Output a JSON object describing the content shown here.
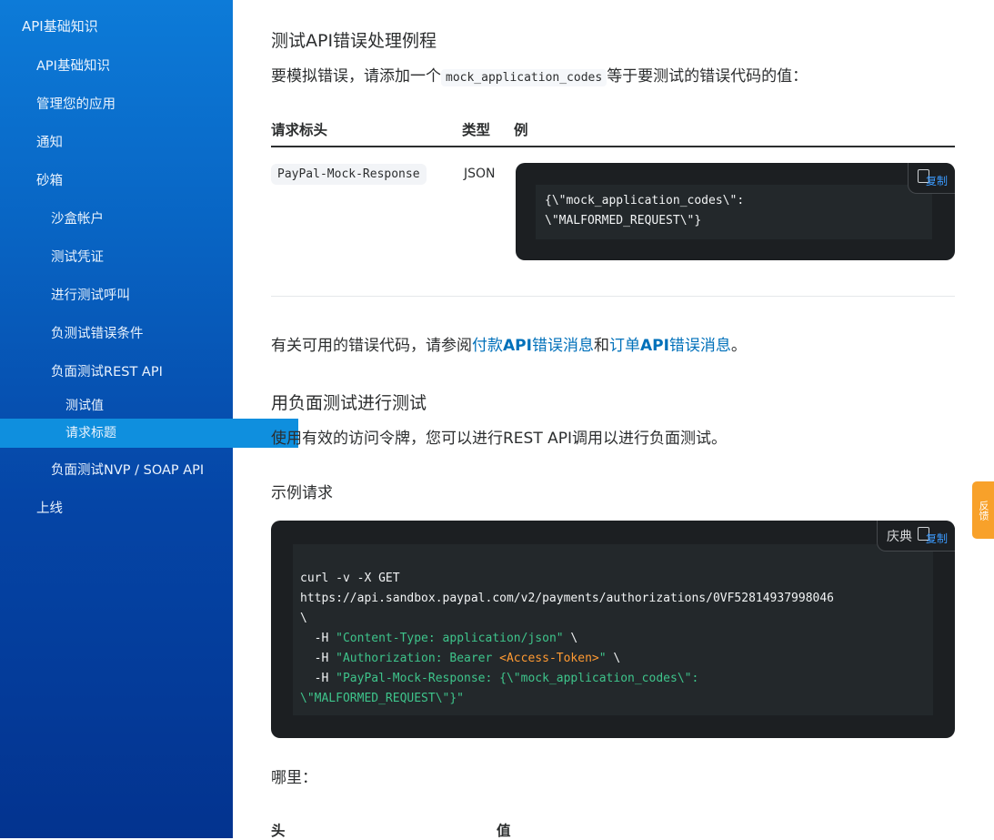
{
  "sidebar": {
    "items": [
      {
        "label": "API基础知识"
      },
      {
        "label": "API基础知识"
      },
      {
        "label": "管理您的应用"
      },
      {
        "label": "通知"
      },
      {
        "label": "砂箱"
      },
      {
        "label": "沙盒帐户"
      },
      {
        "label": "测试凭证"
      },
      {
        "label": "进行测试呼叫"
      },
      {
        "label": "负测试错误条件"
      },
      {
        "label": "负面测试REST API"
      },
      {
        "label": "测试值"
      },
      {
        "label": "请求标题"
      },
      {
        "label": "负面测试NVP / SOAP API"
      },
      {
        "label": "上线"
      }
    ]
  },
  "main": {
    "section1_title": "测试API错误处理例程",
    "intro_before": "要模拟错误，请添加一个",
    "intro_code": "mock_application_codes",
    "intro_after": "等于要测试的错误代码的值：",
    "table": {
      "headers": [
        "请求标头",
        "类型",
        "例"
      ],
      "row": {
        "header": "PayPal-Mock-Response",
        "type": "JSON",
        "example_line1": "{\\\"mock_application_codes\\\":",
        "example_line2": "\\\"MALFORMED_REQUEST\\\"}"
      }
    },
    "copy_label": "复制",
    "errors_before": "有关可用的错误代码，请参阅",
    "errors_link1_pre": "付款",
    "errors_link1_bold": "API",
    "errors_link1_post": "错误消息",
    "errors_mid": "和",
    "errors_link2_pre": "订单",
    "errors_link2_bold": "API",
    "errors_link2_post": "错误消息",
    "errors_end": "。",
    "section2_title": "用负面测试进行测试",
    "section2_desc": "使用有效的访问令牌，您可以进行REST API调用以进行负面测试。",
    "sample_label": "示例请求",
    "sample_lang": "庆典",
    "code": {
      "l1": "curl -v -X GET",
      "l2": "https://api.sandbox.paypal.com/v2/payments/authorizations/0VF52814937998046",
      "l3": "\\",
      "l4_pre": "  -H ",
      "l4_str": "\"Content-Type: application/json\"",
      "l4_post": " \\",
      "l5_pre": "  -H ",
      "l5_str1": "\"Authorization: Bearer ",
      "l5_ph": "<Access-Token>",
      "l5_str2": "\"",
      "l5_post": " \\",
      "l6_pre": "  -H ",
      "l6_str": "\"PayPal-Mock-Response: {\\\"mock_application_codes\\\":",
      "l7_str": "\\\"MALFORMED_REQUEST\\\"}\""
    },
    "where_label": "哪里：",
    "bottom_headers": [
      "头",
      "值"
    ]
  },
  "feedback_label": "反馈"
}
